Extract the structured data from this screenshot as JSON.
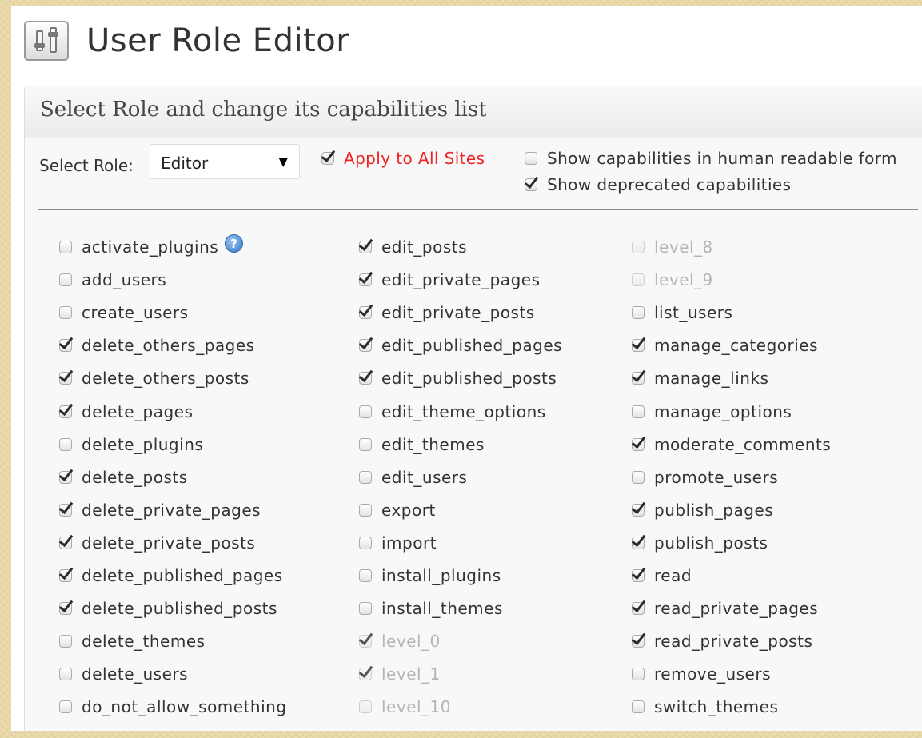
{
  "header": {
    "title": "User Role Editor"
  },
  "panel": {
    "title": "Select Role and change its capabilities list"
  },
  "role": {
    "label": "Select Role:",
    "selected": "Editor"
  },
  "options": {
    "apply_all": {
      "label": "Apply to All Sites",
      "checked": true
    },
    "human_readable": {
      "label": "Show capabilities in human readable form",
      "checked": false
    },
    "show_deprecated": {
      "label": "Show deprecated capabilities",
      "checked": true
    }
  },
  "capabilities": {
    "col1": [
      {
        "name": "activate_plugins",
        "checked": false,
        "deprecated": false,
        "help": true
      },
      {
        "name": "add_users",
        "checked": false,
        "deprecated": false
      },
      {
        "name": "create_users",
        "checked": false,
        "deprecated": false
      },
      {
        "name": "delete_others_pages",
        "checked": true,
        "deprecated": false
      },
      {
        "name": "delete_others_posts",
        "checked": true,
        "deprecated": false
      },
      {
        "name": "delete_pages",
        "checked": true,
        "deprecated": false
      },
      {
        "name": "delete_plugins",
        "checked": false,
        "deprecated": false
      },
      {
        "name": "delete_posts",
        "checked": true,
        "deprecated": false
      },
      {
        "name": "delete_private_pages",
        "checked": true,
        "deprecated": false
      },
      {
        "name": "delete_private_posts",
        "checked": true,
        "deprecated": false
      },
      {
        "name": "delete_published_pages",
        "checked": true,
        "deprecated": false
      },
      {
        "name": "delete_published_posts",
        "checked": true,
        "deprecated": false
      },
      {
        "name": "delete_themes",
        "checked": false,
        "deprecated": false
      },
      {
        "name": "delete_users",
        "checked": false,
        "deprecated": false
      },
      {
        "name": "do_not_allow_something",
        "checked": false,
        "deprecated": false
      }
    ],
    "col2": [
      {
        "name": "edit_posts",
        "checked": true,
        "deprecated": false
      },
      {
        "name": "edit_private_pages",
        "checked": true,
        "deprecated": false
      },
      {
        "name": "edit_private_posts",
        "checked": true,
        "deprecated": false
      },
      {
        "name": "edit_published_pages",
        "checked": true,
        "deprecated": false
      },
      {
        "name": "edit_published_posts",
        "checked": true,
        "deprecated": false
      },
      {
        "name": "edit_theme_options",
        "checked": false,
        "deprecated": false
      },
      {
        "name": "edit_themes",
        "checked": false,
        "deprecated": false
      },
      {
        "name": "edit_users",
        "checked": false,
        "deprecated": false
      },
      {
        "name": "export",
        "checked": false,
        "deprecated": false
      },
      {
        "name": "import",
        "checked": false,
        "deprecated": false
      },
      {
        "name": "install_plugins",
        "checked": false,
        "deprecated": false
      },
      {
        "name": "install_themes",
        "checked": false,
        "deprecated": false
      },
      {
        "name": "level_0",
        "checked": true,
        "deprecated": true
      },
      {
        "name": "level_1",
        "checked": true,
        "deprecated": true
      },
      {
        "name": "level_10",
        "checked": false,
        "deprecated": true
      }
    ],
    "col3": [
      {
        "name": "level_8",
        "checked": false,
        "deprecated": true
      },
      {
        "name": "level_9",
        "checked": false,
        "deprecated": true
      },
      {
        "name": "list_users",
        "checked": false,
        "deprecated": false
      },
      {
        "name": "manage_categories",
        "checked": true,
        "deprecated": false
      },
      {
        "name": "manage_links",
        "checked": true,
        "deprecated": false
      },
      {
        "name": "manage_options",
        "checked": false,
        "deprecated": false
      },
      {
        "name": "moderate_comments",
        "checked": true,
        "deprecated": false
      },
      {
        "name": "promote_users",
        "checked": false,
        "deprecated": false
      },
      {
        "name": "publish_pages",
        "checked": true,
        "deprecated": false
      },
      {
        "name": "publish_posts",
        "checked": true,
        "deprecated": false
      },
      {
        "name": "read",
        "checked": true,
        "deprecated": false
      },
      {
        "name": "read_private_pages",
        "checked": true,
        "deprecated": false
      },
      {
        "name": "read_private_posts",
        "checked": true,
        "deprecated": false
      },
      {
        "name": "remove_users",
        "checked": false,
        "deprecated": false
      },
      {
        "name": "switch_themes",
        "checked": false,
        "deprecated": false
      }
    ]
  },
  "icons": {
    "app": "user-role-editor-icon",
    "help": "help-icon",
    "dropdown": "chevron-down-icon"
  },
  "colors": {
    "apply_label": "#ee2222",
    "deprecated_label": "#b5b5b5",
    "help_icon": "#2f78c9"
  }
}
